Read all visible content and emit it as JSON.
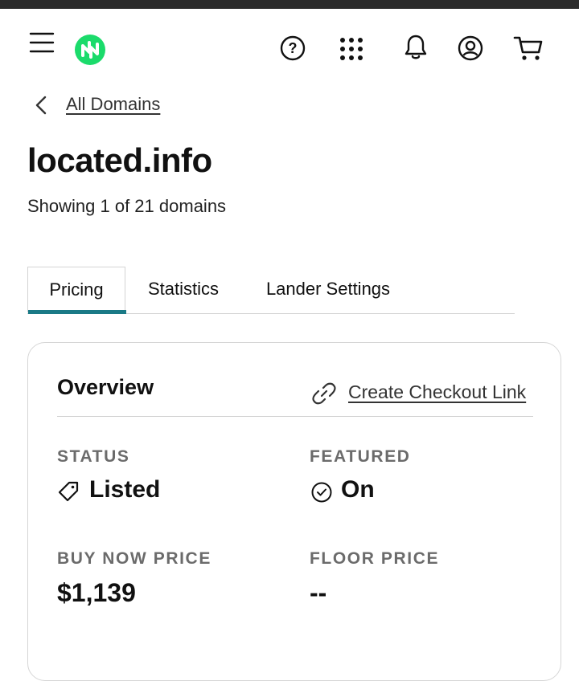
{
  "header": {
    "icons": {
      "menu": "hamburger-menu-icon",
      "logo": "brand-logo",
      "help": "help-icon",
      "apps": "app-grid-icon",
      "notifications": "bell-icon",
      "account": "user-icon",
      "cart": "cart-icon"
    },
    "brand_color": "#1bdb6b"
  },
  "breadcrumb": {
    "back_label": "All Domains"
  },
  "page": {
    "title": "located.info",
    "showing_text": "Showing 1 of 21 domains"
  },
  "tabs": [
    {
      "label": "Pricing",
      "active": true
    },
    {
      "label": "Statistics",
      "active": false
    },
    {
      "label": "Lander Settings",
      "active": false
    }
  ],
  "tab_accent_color": "#1a7a86",
  "overview": {
    "title": "Overview",
    "checkout_link_label": "Create Checkout Link",
    "status": {
      "label": "STATUS",
      "value": "Listed"
    },
    "featured": {
      "label": "FEATURED",
      "value": "On"
    },
    "buy_now_price": {
      "label": "BUY NOW PRICE",
      "value": "$1,139"
    },
    "floor_price": {
      "label": "FLOOR PRICE",
      "value": "--"
    }
  }
}
